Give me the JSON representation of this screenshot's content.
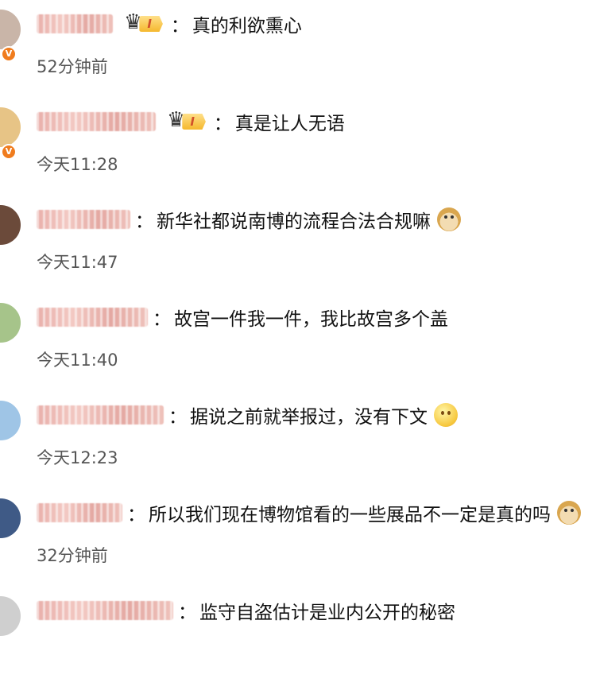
{
  "comments": [
    {
      "time": "52分钟前",
      "text": "真的利欲熏心",
      "crown": true,
      "level": "I",
      "emoji": "",
      "vbadge": true,
      "avatar_color": "#c9b5a8"
    },
    {
      "time": "今天11:28",
      "text": "真是让人无语",
      "crown": true,
      "level": "I",
      "emoji": "",
      "vbadge": true,
      "avatar_color": "#e7c486"
    },
    {
      "time": "今天11:47",
      "text": "新华社都说南博的流程合法合规嘛",
      "crown": false,
      "level": "",
      "emoji": "dog-face-icon",
      "vbadge": false,
      "avatar_color": "#6b4a3a"
    },
    {
      "time": "今天11:40",
      "text": "故宫一件我一件，我比故宫多个盖",
      "crown": false,
      "level": "",
      "emoji": "",
      "vbadge": false,
      "avatar_color": "#a6c48a"
    },
    {
      "time": "今天12:23",
      "text": "据说之前就举报过，没有下文",
      "crown": false,
      "level": "",
      "emoji": "smile-face-icon",
      "vbadge": false,
      "avatar_color": "#9fc5e6"
    },
    {
      "time": "32分钟前",
      "text": "所以我们现在博物馆看的一些展品不一定是真的吗",
      "crown": false,
      "level": "",
      "emoji": "dog-face-icon",
      "vbadge": false,
      "avatar_color": "#3f5a86"
    },
    {
      "time": "",
      "text": "监守自盗估计是业内公开的秘密",
      "crown": false,
      "level": "",
      "emoji": "",
      "vbadge": false,
      "avatar_color": "#cfcfcf"
    }
  ],
  "colon": "："
}
